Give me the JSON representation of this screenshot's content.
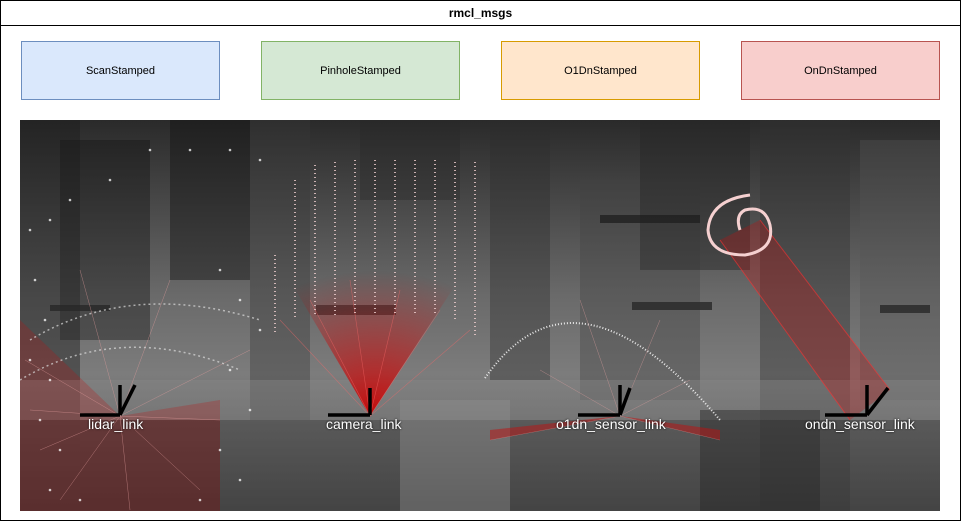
{
  "title": "rmcl_msgs",
  "boxes": [
    {
      "label": "ScanStamped",
      "fill": "#dae8fc",
      "stroke": "#6c8ebf"
    },
    {
      "label": "PinholeStamped",
      "fill": "#d5e8d4",
      "stroke": "#82b366"
    },
    {
      "label": "O1DnStamped",
      "fill": "#ffe6cc",
      "stroke": "#d79b00"
    },
    {
      "label": "OnDnStamped",
      "fill": "#f8cecc",
      "stroke": "#b85450"
    }
  ],
  "scene": {
    "frames": [
      {
        "label": "lidar_link"
      },
      {
        "label": "camera_link"
      },
      {
        "label": "o1dn_sensor_link"
      },
      {
        "label": "ondn_sensor_link"
      }
    ]
  }
}
